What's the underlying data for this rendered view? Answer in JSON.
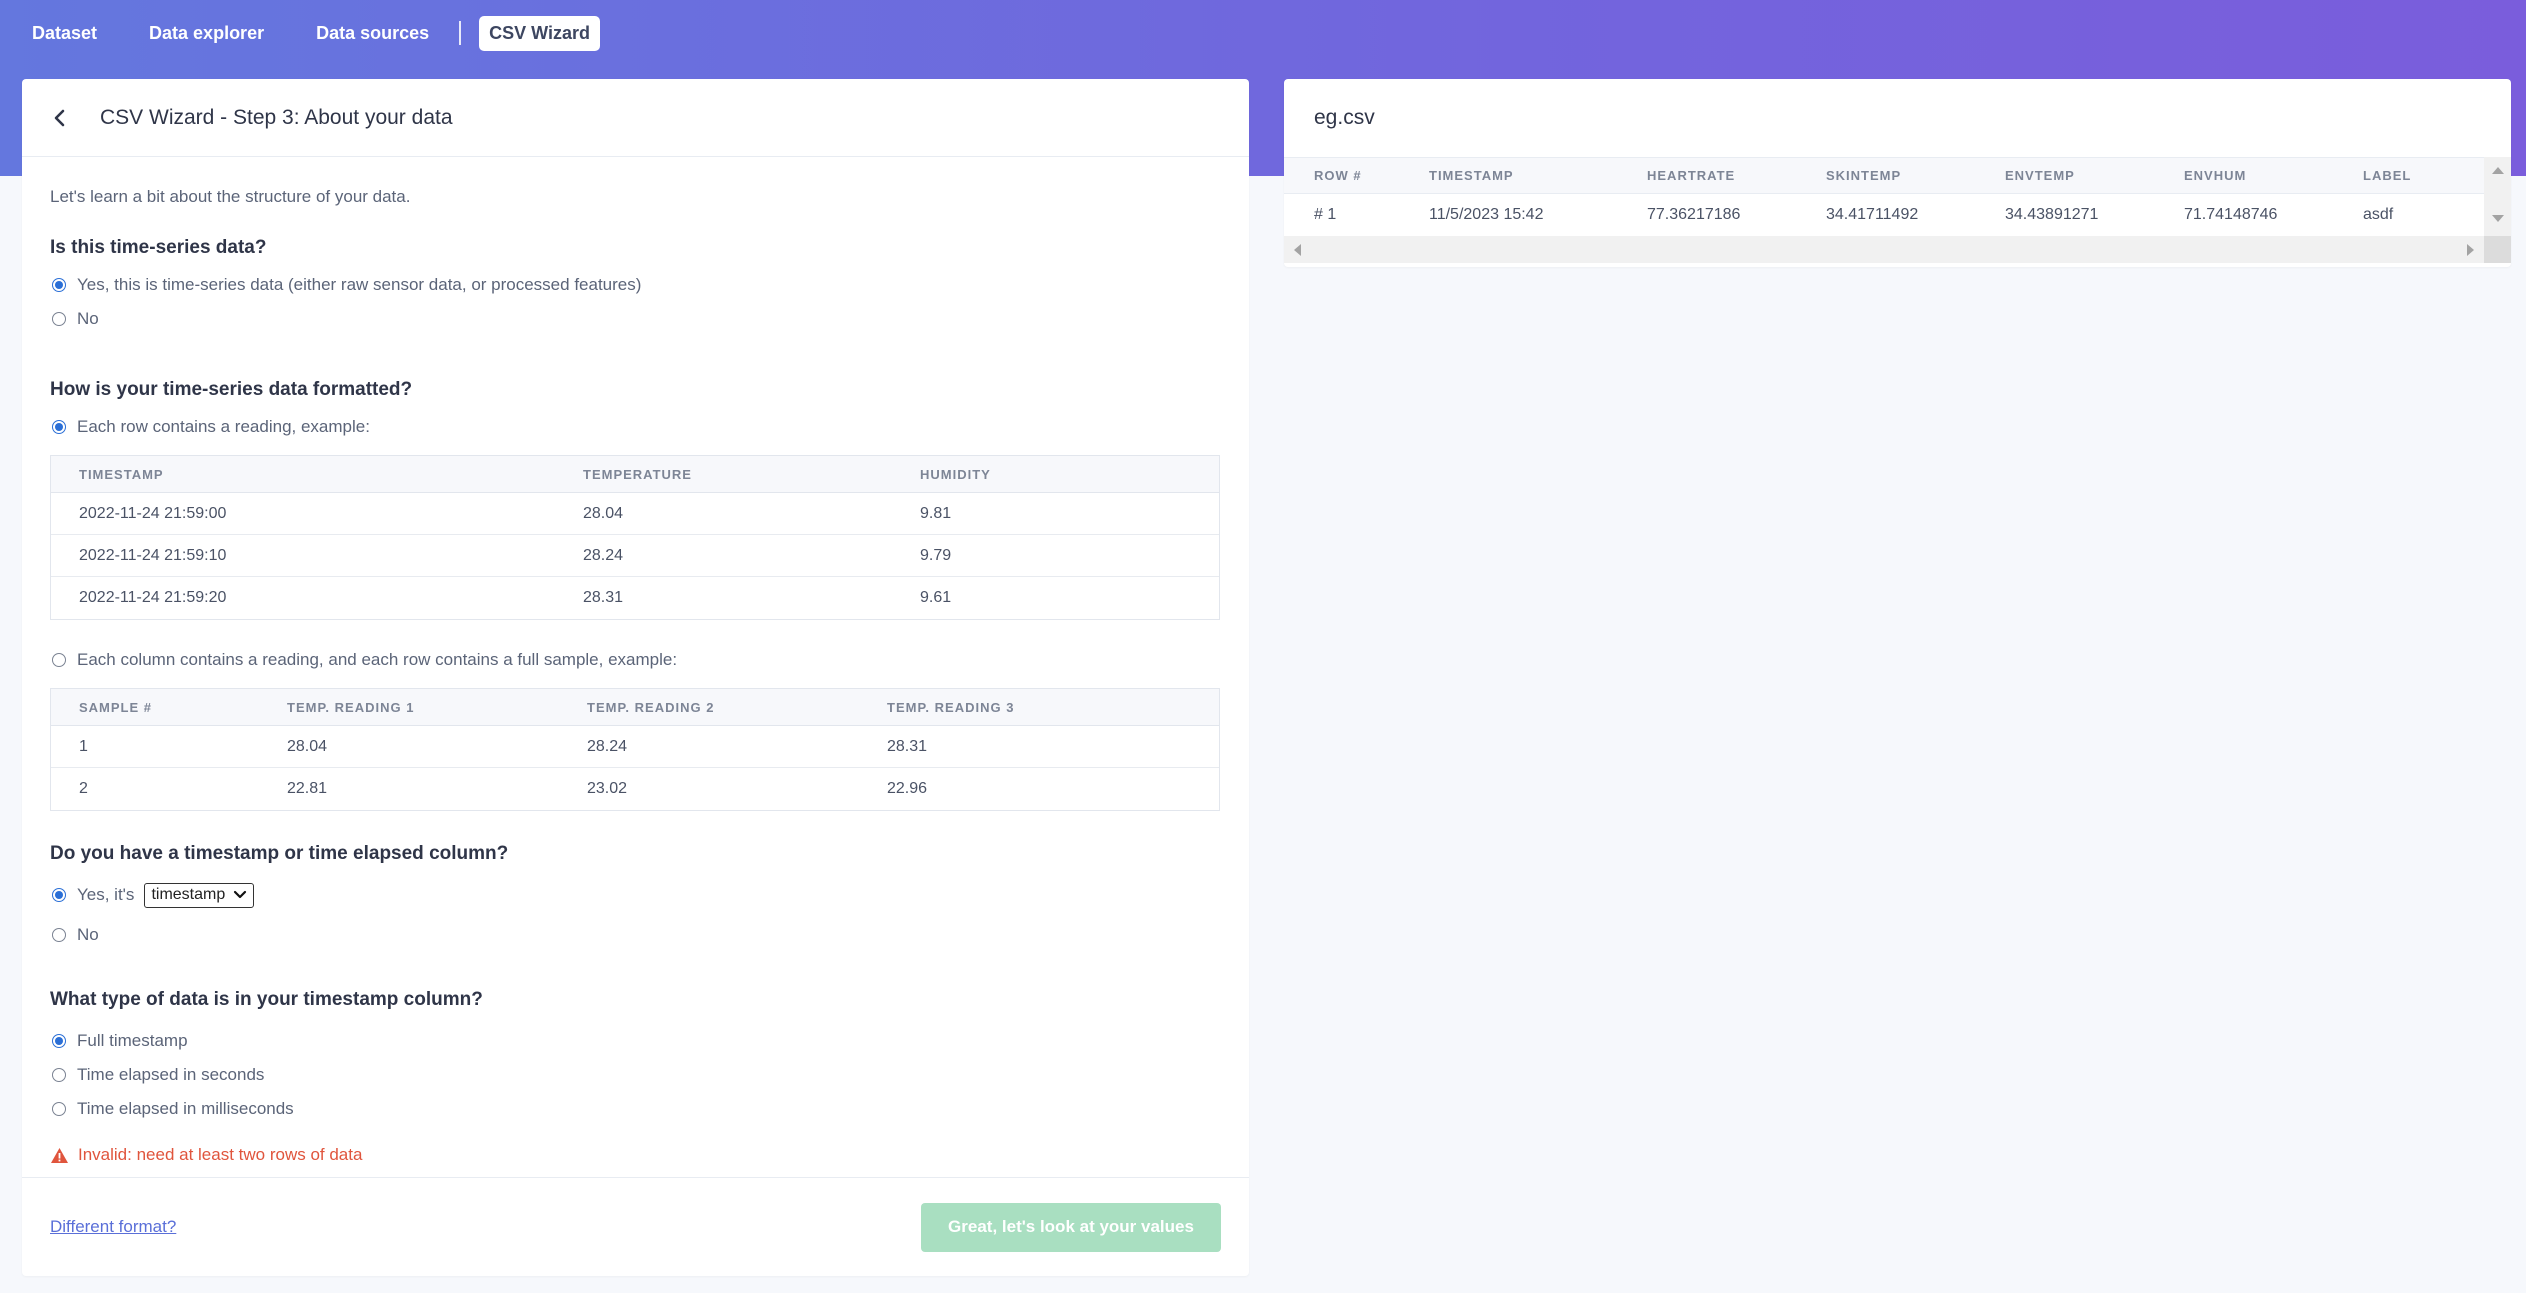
{
  "nav": {
    "tabs": [
      {
        "label": "Dataset"
      },
      {
        "label": "Data explorer"
      },
      {
        "label": "Data sources"
      },
      {
        "label": "CSV Wizard",
        "active": true
      }
    ]
  },
  "wizard": {
    "title": "CSV Wizard - Step 3: About your data",
    "intro": "Let's learn a bit about the structure of your data.",
    "q1": {
      "question": "Is this time-series data?",
      "options": [
        "Yes, this is time-series data (either raw sensor data, or processed features)",
        "No"
      ],
      "selected": 0
    },
    "q2": {
      "question": "How is your time-series data formatted?",
      "option_row": "Each row contains a reading, example:",
      "row_table": {
        "headers": [
          "TIMESTAMP",
          "TEMPERATURE",
          "HUMIDITY"
        ],
        "rows": [
          [
            "2022-11-24 21:59:00",
            "28.04",
            "9.81"
          ],
          [
            "2022-11-24 21:59:10",
            "28.24",
            "9.79"
          ],
          [
            "2022-11-24 21:59:20",
            "28.31",
            "9.61"
          ]
        ]
      },
      "option_col": "Each column contains a reading, and each row contains a full sample, example:",
      "col_table": {
        "headers": [
          "SAMPLE #",
          "TEMP. READING 1",
          "TEMP. READING 2",
          "TEMP. READING 3"
        ],
        "rows": [
          [
            "1",
            "28.04",
            "28.24",
            "28.31"
          ],
          [
            "2",
            "22.81",
            "23.02",
            "22.96"
          ]
        ]
      },
      "selected": 0
    },
    "q3": {
      "question": "Do you have a timestamp or time elapsed column?",
      "yes_label": "Yes, it's",
      "select_value": "timestamp",
      "no_label": "No",
      "selected": 0
    },
    "q4": {
      "question": "What type of data is in your timestamp column?",
      "options": [
        "Full timestamp",
        "Time elapsed in seconds",
        "Time elapsed in milliseconds"
      ],
      "selected": 0
    },
    "error": "Invalid: need at least two rows of data",
    "footer": {
      "link": "Different format?",
      "button": "Great, let's look at your values"
    }
  },
  "preview": {
    "filename": "eg.csv",
    "headers": [
      "ROW #",
      "TIMESTAMP",
      "HEARTRATE",
      "SKINTEMP",
      "ENVTEMP",
      "ENVHUM",
      "LABEL"
    ],
    "rows": [
      [
        "# 1",
        "11/5/2023 15:42",
        "77.36217186",
        "34.41711492",
        "34.43891271",
        "71.74148746",
        "asdf"
      ]
    ]
  },
  "colors": {
    "header_gradient_start": "#6477de",
    "header_gradient_end": "#7a5ddc",
    "radio_checked": "#2b6fd6",
    "error": "#e0553d",
    "button_disabled": "#a9dfc1",
    "link": "#5a6fd8"
  }
}
